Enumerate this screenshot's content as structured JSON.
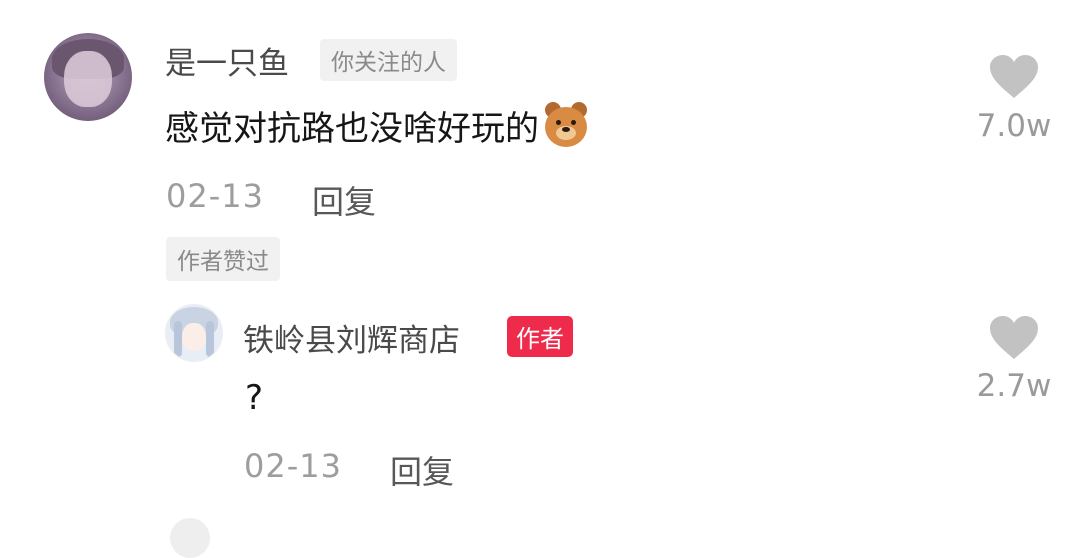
{
  "comment": {
    "username": "是一只鱼",
    "follow_tag": "你关注的人",
    "text": "感觉对抗路也没啥好玩的",
    "emoji_icon": "bear-face-emoji",
    "date": "02-13",
    "reply_label": "回复",
    "likes": "7.0w",
    "liked_by_author_tag": "作者赞过"
  },
  "reply": {
    "username": "铁岭县刘辉商店",
    "author_tag": "作者",
    "text": "?",
    "date": "02-13",
    "reply_label": "回复",
    "likes": "2.7w"
  },
  "colors": {
    "author_tag_bg": "#ef2b4c",
    "heart": "#c2c2c2",
    "date": "#9d9d9d"
  }
}
